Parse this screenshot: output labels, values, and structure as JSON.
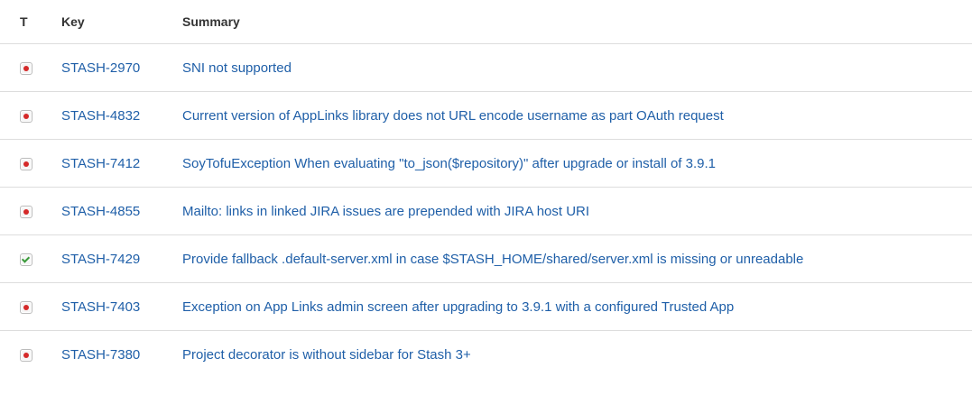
{
  "headers": {
    "type": "T",
    "key": "Key",
    "summary": "Summary"
  },
  "issues": [
    {
      "type_icon": "bug-icon",
      "key": "STASH-2970",
      "summary": "SNI not supported"
    },
    {
      "type_icon": "bug-icon",
      "key": "STASH-4832",
      "summary": "Current version of AppLinks library does not URL encode username as part OAuth request"
    },
    {
      "type_icon": "bug-icon",
      "key": "STASH-7412",
      "summary": "SoyTofuException When evaluating \"to_json($repository)\" after upgrade or install of 3.9.1"
    },
    {
      "type_icon": "bug-icon",
      "key": "STASH-4855",
      "summary": "Mailto: links in linked JIRA issues are prepended with JIRA host URI"
    },
    {
      "type_icon": "task-icon",
      "key": "STASH-7429",
      "summary": "Provide fallback .default-server.xml in case $STASH_HOME/shared/server.xml is missing or unreadable"
    },
    {
      "type_icon": "bug-icon",
      "key": "STASH-7403",
      "summary": "Exception on App Links admin screen after upgrading to 3.9.1 with a configured Trusted App"
    },
    {
      "type_icon": "bug-icon",
      "key": "STASH-7380",
      "summary": "Project decorator is without sidebar for Stash 3+"
    }
  ],
  "colors": {
    "link": "#1f5fa8",
    "bug": "#d52a2a",
    "task": "#3a9a3a",
    "divider": "#dddddd"
  }
}
